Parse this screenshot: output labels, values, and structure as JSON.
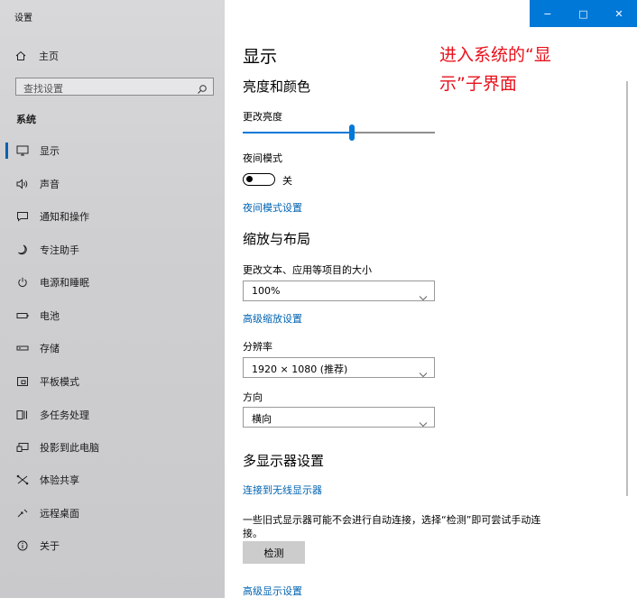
{
  "window": {
    "title": "设置",
    "controls": {
      "minimize": "−",
      "maximize": "□",
      "close": "✕"
    }
  },
  "sidebar": {
    "home": "主页",
    "search_placeholder": "查找设置",
    "section": "系统",
    "items": [
      {
        "label": "显示",
        "icon": "monitor-icon",
        "selected": true
      },
      {
        "label": "声音",
        "icon": "speaker-icon"
      },
      {
        "label": "通知和操作",
        "icon": "notification-icon"
      },
      {
        "label": "专注助手",
        "icon": "moon-icon"
      },
      {
        "label": "电源和睡眠",
        "icon": "power-icon"
      },
      {
        "label": "电池",
        "icon": "battery-icon"
      },
      {
        "label": "存储",
        "icon": "storage-icon"
      },
      {
        "label": "平板模式",
        "icon": "tablet-icon"
      },
      {
        "label": "多任务处理",
        "icon": "multitask-icon"
      },
      {
        "label": "投影到此电脑",
        "icon": "project-icon"
      },
      {
        "label": "体验共享",
        "icon": "shared-icon"
      },
      {
        "label": "远程桌面",
        "icon": "remote-icon"
      },
      {
        "label": "关于",
        "icon": "info-icon"
      }
    ]
  },
  "main": {
    "title": "显示",
    "annotation": [
      "进入系统的“显",
      "示”子界面"
    ],
    "brightness": {
      "heading": "亮度和颜色",
      "label": "更改亮度",
      "value_fraction": 0.57,
      "night_label": "夜间模式",
      "night_state": "关",
      "night_link": "夜间模式设置"
    },
    "scale": {
      "heading": "缩放与布局",
      "size_label": "更改文本、应用等项目的大小",
      "size_value": "100%",
      "advanced_link": "高级缩放设置",
      "resolution_label": "分辨率",
      "resolution_value": "1920 × 1080 (推荐)",
      "orientation_label": "方向",
      "orientation_value": "横向"
    },
    "multi": {
      "heading": "多显示器设置",
      "connect_link": "连接到无线显示器",
      "desc_line1": "一些旧式显示器可能不会进行自动连接，选择“检测”即可尝试手动连",
      "desc_line2": "接。",
      "detect_button": "检测",
      "advanced_link": "高级显示设置"
    }
  },
  "colors": {
    "accent": "#0078d7",
    "link": "#0063b1",
    "annotation": "#e8101b"
  }
}
